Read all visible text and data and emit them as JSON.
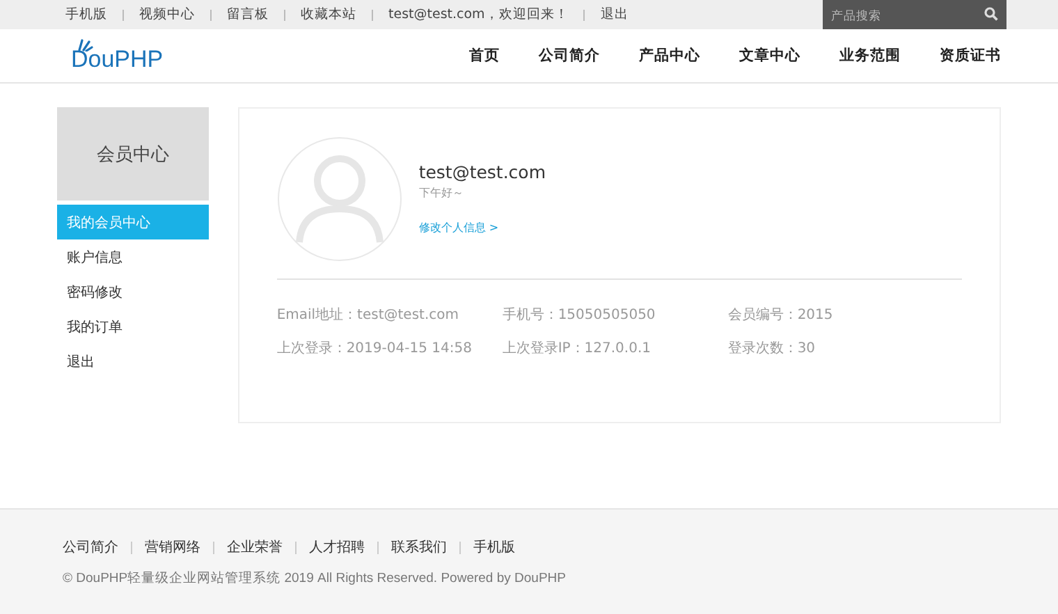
{
  "top_links": [
    "手机版",
    "视频中心",
    "留言板",
    "收藏本站",
    "test@test.com，欢迎回来！",
    "退出"
  ],
  "search": {
    "placeholder": "产品搜索"
  },
  "logo": "DouPHP",
  "nav": [
    "首页",
    "公司简介",
    "产品中心",
    "文章中心",
    "业务范围",
    "资质证书"
  ],
  "sidebar": {
    "title": "会员中心",
    "items": [
      {
        "label": "我的会员中心",
        "selected": true
      },
      {
        "label": "账户信息",
        "selected": false
      },
      {
        "label": "密码修改",
        "selected": false
      },
      {
        "label": "我的订单",
        "selected": false
      },
      {
        "label": "退出",
        "selected": false
      }
    ]
  },
  "profile": {
    "name": "test@test.com",
    "greeting": "下午好～",
    "edit_link": "修改个人信息 >"
  },
  "info": [
    "Email地址：test@test.com",
    "手机号：15050505050",
    "会员编号：2015",
    "上次登录：2019-04-15 14:58",
    "上次登录IP：127.0.0.1",
    "登录次数：30"
  ],
  "footer": {
    "links": [
      "公司简介",
      "营销网络",
      "企业荣誉",
      "人才招聘",
      "联系我们",
      "手机版"
    ],
    "copyright": "© DouPHP轻量级企业网站管理系统 2019 All Rights Reserved. Powered by DouPHP"
  }
}
